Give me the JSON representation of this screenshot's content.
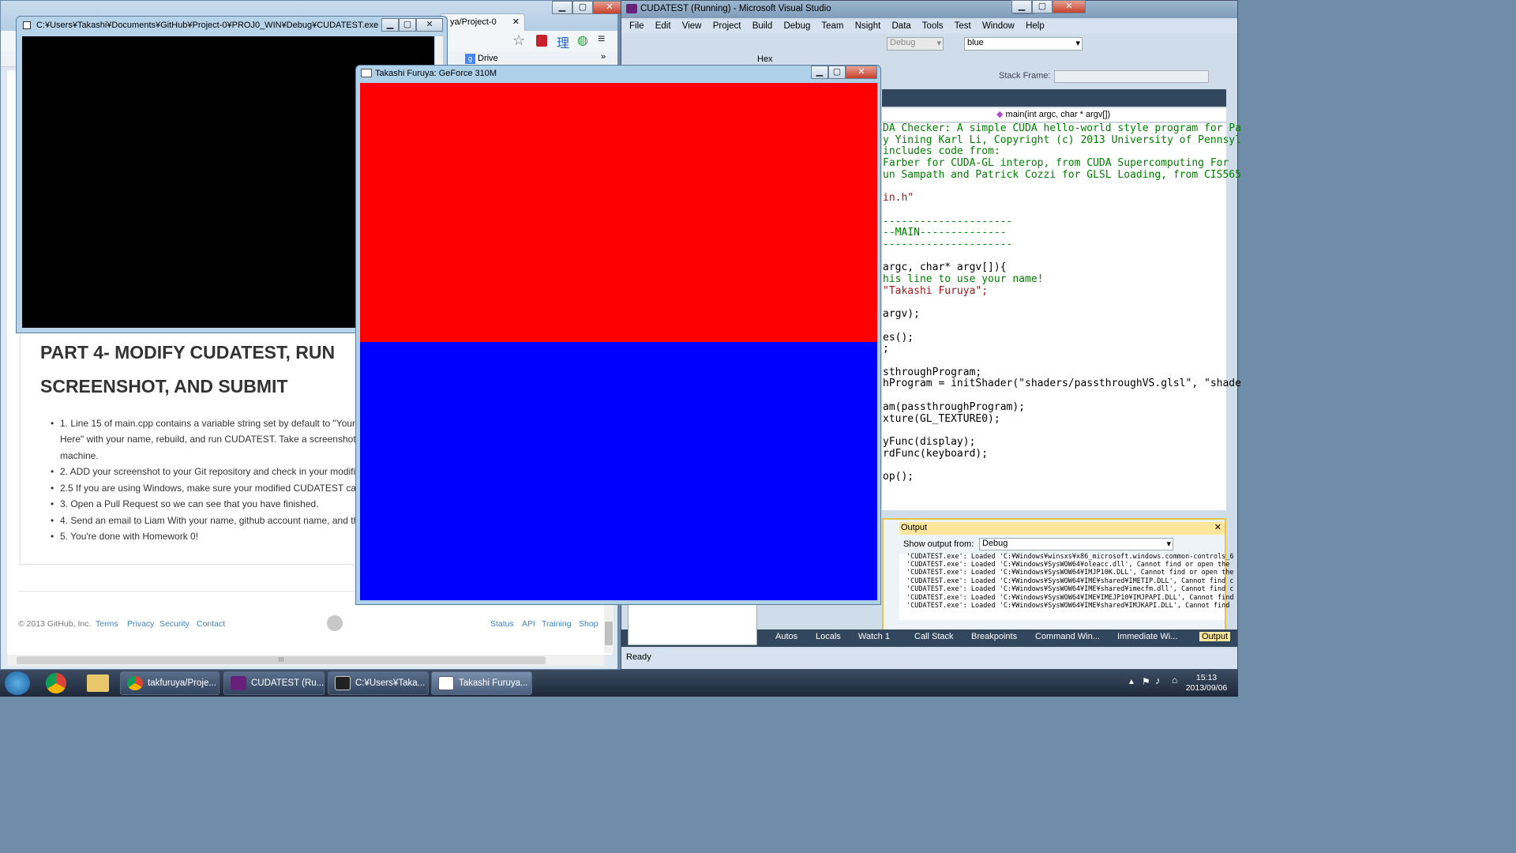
{
  "chrome": {
    "tab_title": "ya/Project-0",
    "bookmark_drive": "Drive",
    "heading_line1": "PART 4- MODIFY CUDATEST, RUN",
    "heading_line2": "SCREENSHOT, AND SUBMIT",
    "list": [
      "1. Line 15 of main.cpp contains a variable string set by default to \"Your",
      "Here\" with your name, rebuild, and run CUDATEST. Take a screenshot",
      "machine.",
      "2. ADD your screenshot to your Git repository and check in your modifie",
      "2.5 If you are using Windows, make sure your modified CUDATEST ca",
      "3. Open a Pull Request so we can see that you have finished.",
      "4. Send an email to Liam With your name, github account name, and th",
      "5. You're done with Homework 0!"
    ],
    "footer": {
      "copyright": "© 2013 GitHub, Inc.",
      "left_links": [
        "Terms",
        "Privacy",
        "Security",
        "Contact"
      ],
      "right_links": [
        "Status",
        "API",
        "Training",
        "Shop"
      ]
    },
    "scroll_grip": "III"
  },
  "console": {
    "title": "C:¥Users¥Takashi¥Documents¥GitHub¥Project-0¥PROJ0_WIN¥Debug¥CUDATEST.exe"
  },
  "gl_window": {
    "title": "Takashi Furuya: GeForce 310M",
    "top_color": "#ff0000",
    "bottom_color": "#0000ff"
  },
  "vs": {
    "title": "CUDATEST (Running) - Microsoft Visual Studio",
    "menu": [
      "File",
      "Edit",
      "View",
      "Project",
      "Build",
      "Debug",
      "Team",
      "Nsight",
      "Data",
      "Tools",
      "Test",
      "Window",
      "Help"
    ],
    "config_select": "Debug",
    "find_box": "blue",
    "hex_label": "Hex",
    "stack_frame_label": "Stack Frame:",
    "function_select": "main(int argc, char * argv[])",
    "code": [
      {
        "t": "DA Checker: A simple CUDA hello-world style program for Pa",
        "c": "#008000"
      },
      {
        "t": "y Yining Karl Li, Copyright (c) 2013 University of Pennsyl",
        "c": "#008000"
      },
      {
        "t": " includes code from:",
        "c": "#008000"
      },
      {
        "t": " Farber for CUDA-GL interop, from CUDA Supercomputing For",
        "c": "#008000"
      },
      {
        "t": "un Sampath and Patrick Cozzi for GLSL Loading, from CIS565",
        "c": "#008000"
      },
      {
        "t": "",
        "c": "#000"
      },
      {
        "t": "in.h\"",
        "c": "#a31515"
      },
      {
        "t": "",
        "c": "#000"
      },
      {
        "t": "---------------------",
        "c": "#008000"
      },
      {
        "t": "--MAIN--------------",
        "c": "#008000"
      },
      {
        "t": "---------------------",
        "c": "#008000"
      },
      {
        "t": "",
        "c": "#000"
      },
      {
        "t": " argc, char* argv[]){",
        "c": "#000"
      },
      {
        "t": "his line to use your name!",
        "c": "#008000"
      },
      {
        "t": " \"Takashi Furuya\";",
        "c": "#a31515"
      },
      {
        "t": "",
        "c": "#000"
      },
      {
        "t": " argv);",
        "c": "#000"
      },
      {
        "t": "",
        "c": "#000"
      },
      {
        "t": "es();",
        "c": "#000"
      },
      {
        "t": ";",
        "c": "#000"
      },
      {
        "t": "",
        "c": "#000"
      },
      {
        "t": "sthroughProgram;",
        "c": "#000"
      },
      {
        "t": "hProgram = initShader(\"shaders/passthroughVS.glsl\", \"shade",
        "c": "#000"
      },
      {
        "t": "",
        "c": "#000"
      },
      {
        "t": "am(passthroughProgram);",
        "c": "#000"
      },
      {
        "t": "xture(GL_TEXTURE0);",
        "c": "#000"
      },
      {
        "t": "",
        "c": "#000"
      },
      {
        "t": "yFunc(display);",
        "c": "#000"
      },
      {
        "t": "rdFunc(keyboard);",
        "c": "#000"
      },
      {
        "t": "",
        "c": "#000"
      },
      {
        "t": "op();",
        "c": "#000"
      }
    ],
    "output": {
      "title": "Output",
      "show_label": "Show output from:",
      "source": "Debug",
      "lines": [
        "'CUDATEST.exe': Loaded 'C:¥Windows¥winsxs¥x86_microsoft.windows.common-controls_6",
        "'CUDATEST.exe': Loaded 'C:¥Windows¥SysWOW64¥oleacc.dll', Cannot find or open the",
        "'CUDATEST.exe': Loaded 'C:¥Windows¥SysWOW64¥IMJP10K.DLL', Cannot find or open the",
        "'CUDATEST.exe': Loaded 'C:¥Windows¥SysWOW64¥IME¥shared¥IMETIP.DLL', Cannot find c",
        "'CUDATEST.exe': Loaded 'C:¥Windows¥SysWOW64¥IME¥shared¥imecfm.dll', Cannot find c",
        "'CUDATEST.exe': Loaded 'C:¥Windows¥SysWOW64¥IME¥IMEJP10¥IMJPAPI.DLL', Cannot find",
        "'CUDATEST.exe': Loaded 'C:¥Windows¥SysWOW64¥IME¥shared¥IMJKAPI.DLL', Cannot find"
      ]
    },
    "bottom_tabs": [
      "Autos",
      "Locals",
      "Watch 1",
      "Call Stack",
      "Breakpoints",
      "Command Win...",
      "Immediate Wi...",
      "Output"
    ],
    "status": "Ready"
  },
  "taskbar": {
    "buttons": [
      "takfuruya/Proje...",
      "CUDATEST (Ru...",
      "C:¥Users¥Taka...",
      "Takashi Furuya..."
    ],
    "clock_time": "15:13",
    "clock_date": "2013/09/06"
  }
}
